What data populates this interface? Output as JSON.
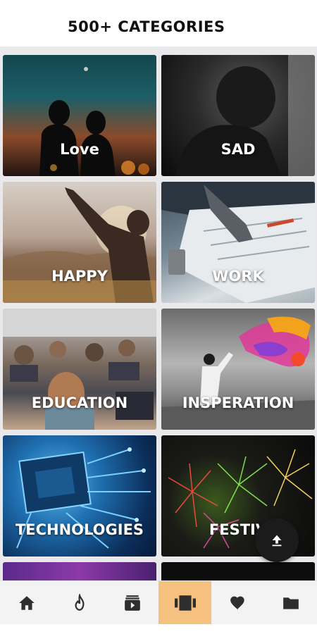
{
  "header": {
    "title": "500+ CATEGORIES"
  },
  "categories": [
    {
      "label": "Love"
    },
    {
      "label": "SAD"
    },
    {
      "label": "HAPPY"
    },
    {
      "label": "WORK"
    },
    {
      "label": "EDUCATION"
    },
    {
      "label": "INSPERATION"
    },
    {
      "label": "TECHNOLOGIES"
    },
    {
      "label": "FESTIV"
    }
  ],
  "nav": {
    "items": [
      "home-icon",
      "fire-icon",
      "video-library-icon",
      "categories-icon",
      "heart-icon",
      "folder-icon"
    ],
    "active_index": 3,
    "active_color": "#f6c07e"
  },
  "fab": {
    "icon": "upload-icon"
  }
}
